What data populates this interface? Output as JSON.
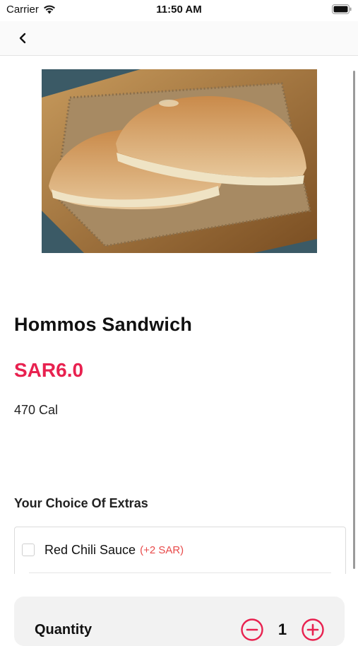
{
  "status_bar": {
    "carrier": "Carrier",
    "time": "11:50 AM"
  },
  "item": {
    "name": "Hommos Sandwich",
    "price": "SAR6.0",
    "calories": "470 Cal",
    "image_icon": "food-photo"
  },
  "extras": {
    "title": "Your Choice Of Extras",
    "options": [
      {
        "label": "Red Chili Sauce",
        "price": "(+2 SAR)",
        "checked": false
      }
    ]
  },
  "quantity": {
    "label": "Quantity",
    "value": "1"
  },
  "colors": {
    "accent": "#e8214f",
    "extra_price": "#e84a4a"
  }
}
